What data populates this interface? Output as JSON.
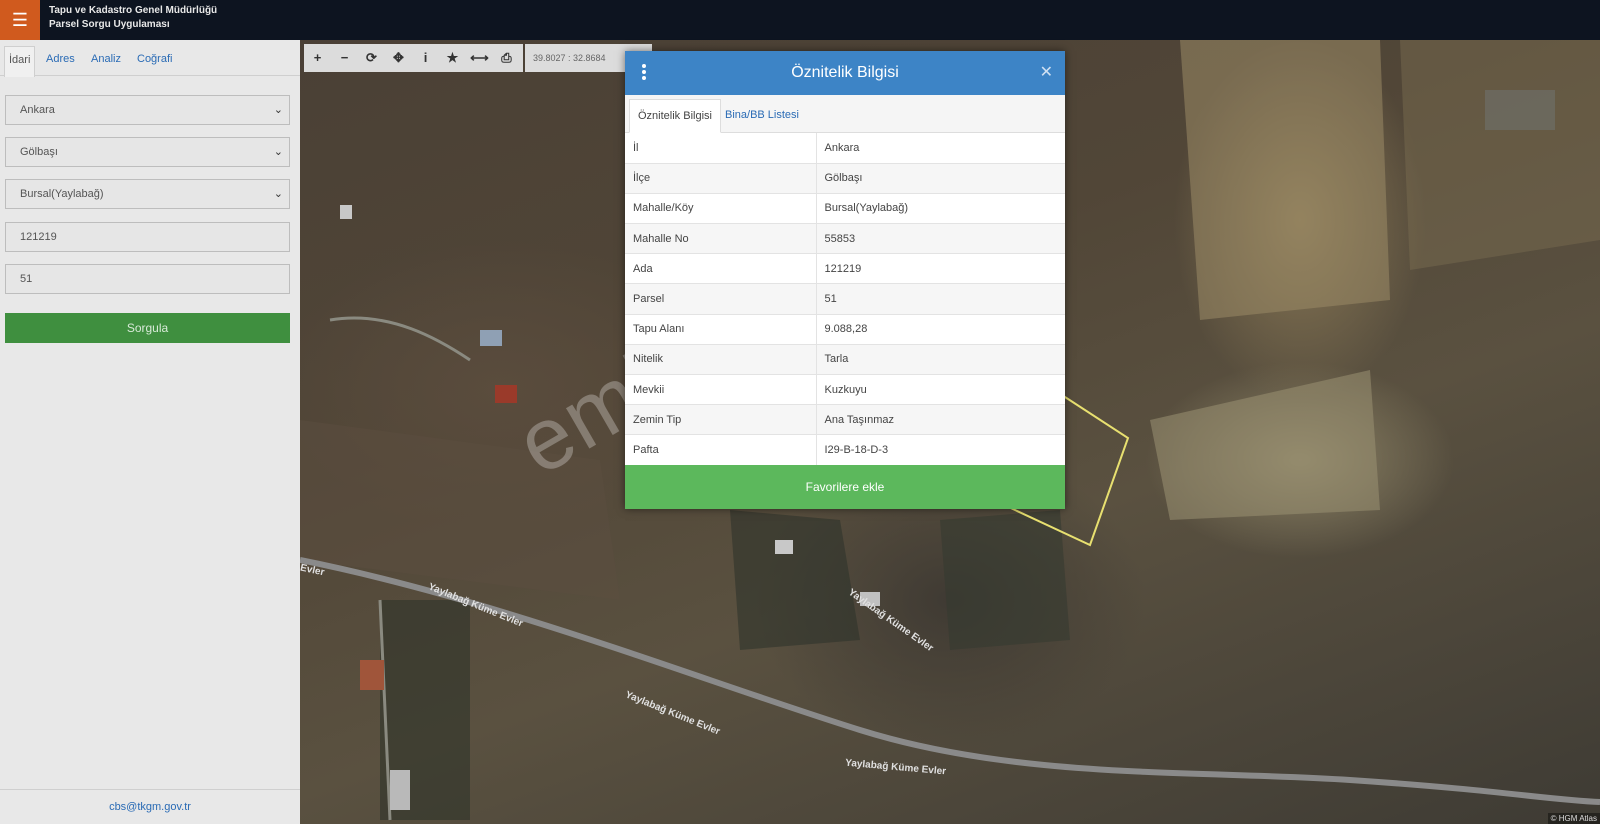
{
  "header": {
    "menu_icon": "hamburger-icon",
    "title_line1": "Tapu ve Kadastro Genel Müdürlüğü",
    "title_line2": "Parsel Sorgu Uygulaması"
  },
  "sidebar": {
    "tabs": [
      {
        "label": "İdari",
        "active": true
      },
      {
        "label": "Adres",
        "active": false
      },
      {
        "label": "Analiz",
        "active": false
      },
      {
        "label": "Coğrafi",
        "active": false
      }
    ],
    "province": "Ankara",
    "district": "Gölbaşı",
    "neighborhood": "Bursal(Yaylabağ)",
    "block": "121219",
    "parcel": "51",
    "query_button": "Sorgula",
    "footer_email": "cbs@tkgm.gov.tr"
  },
  "map": {
    "coords": "39.8027 : 32.8684",
    "tools": [
      "zoom-in-icon",
      "zoom-out-icon",
      "refresh-icon",
      "locate-icon",
      "info-icon",
      "star-icon",
      "measure-icon",
      "print-icon"
    ],
    "watermark": "emlakjet.com",
    "road_labels": [
      "Yaylabağ Küme Evler",
      "Yaylabağ Küme Evler",
      "Yaylabağ Küme Evler",
      "Yaylabağ Küme Evler",
      "Evler"
    ],
    "attribution": "© HGM Atlas"
  },
  "modal": {
    "title": "Öznitelik Bilgisi",
    "tabs": [
      {
        "label": "Öznitelik Bilgisi",
        "active": true
      },
      {
        "label": "Bina/BB Listesi",
        "active": false
      }
    ],
    "rows": [
      {
        "key": "İl",
        "value": "Ankara"
      },
      {
        "key": "İlçe",
        "value": "Gölbaşı"
      },
      {
        "key": "Mahalle/Köy",
        "value": "Bursal(Yaylabağ)"
      },
      {
        "key": "Mahalle No",
        "value": "55853"
      },
      {
        "key": "Ada",
        "value": "121219"
      },
      {
        "key": "Parsel",
        "value": "51"
      },
      {
        "key": "Tapu Alanı",
        "value": "9.088,28"
      },
      {
        "key": "Nitelik",
        "value": "Tarla"
      },
      {
        "key": "Mevkii",
        "value": "Kuzkuyu"
      },
      {
        "key": "Zemin Tip",
        "value": "Ana Taşınmaz"
      },
      {
        "key": "Pafta",
        "value": "I29-B-18-D-3"
      }
    ],
    "fav_button": "Favorilere ekle"
  },
  "colors": {
    "header_bg": "#0d1420",
    "menu_accent": "#d05a1e",
    "modal_header": "#3d84c6",
    "query_button": "#3f8f3f",
    "fav_button": "#5cb85c",
    "parcel_outline": "#e8e070"
  }
}
